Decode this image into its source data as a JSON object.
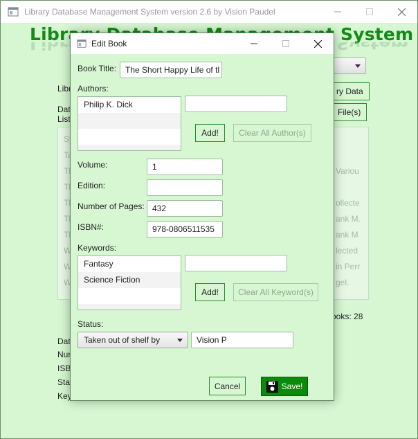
{
  "main_window": {
    "title": "Library Database Management System version 2.6 by Vision Paudel",
    "heading": "Library Database Management System",
    "reflection": "Library Database Management System",
    "bg_labels": {
      "libr": "Libr",
      "dat1": "Dat",
      "list": "List",
      "dat2": "Dat",
      "nur": "Nur",
      "isbn": "ISBI",
      "stat": "Stat",
      "key": "Key"
    },
    "bg_buttons": {
      "data": "ry Data",
      "files": "File(s)"
    },
    "book_count": "ooks: 28",
    "bg_rows": {
      "r0": "Sy",
      "r1": "Ta",
      "r2": "Th",
      "r2b": "Variou",
      "r3": "Th",
      "r4": "Th",
      "r4b": "ollecte",
      "r5": "Th",
      "r5b": "ank M.",
      "r6": "Th",
      "r6b": "ank M",
      "r7": "W",
      "r7b": "lected",
      "r8": "W",
      "r8b": "in Perr",
      "r9": "W",
      "r9b": "gel."
    }
  },
  "dialog": {
    "title": "Edit Book",
    "book_title_label": "Book Title:",
    "book_title_value": "The Short Happy Life of tl",
    "authors_label": "Authors:",
    "authors": [
      "Philip K. Dick",
      "",
      "",
      ""
    ],
    "author_input_value": "",
    "add_author_label": "Add!",
    "clear_authors_label": "Clear All Author(s)",
    "volume_label": "Volume:",
    "volume_value": "1",
    "edition_label": "Edition:",
    "edition_value": "",
    "pages_label": "Number of Pages:",
    "pages_value": "432",
    "isbn_label": "ISBN#:",
    "isbn_value": "978-0806511535",
    "keywords_label": "Keywords:",
    "keywords": [
      "Fantasy",
      "Science Fiction",
      "",
      ""
    ],
    "keyword_input_value": "",
    "add_keyword_label": "Add!",
    "clear_keywords_label": "Clear All Keyword(s)",
    "status_label": "Status:",
    "status_selected": "Taken out of shelf by",
    "status_by_value": "Vision P",
    "cancel_label": "Cancel",
    "save_label": "Save!"
  },
  "colors": {
    "background": "#d6f7d2",
    "accent_green": "#168a16",
    "save_green": "#0c8a0c"
  },
  "icons": {
    "app": "app-window-icon",
    "save": "floppy-disk-icon"
  }
}
